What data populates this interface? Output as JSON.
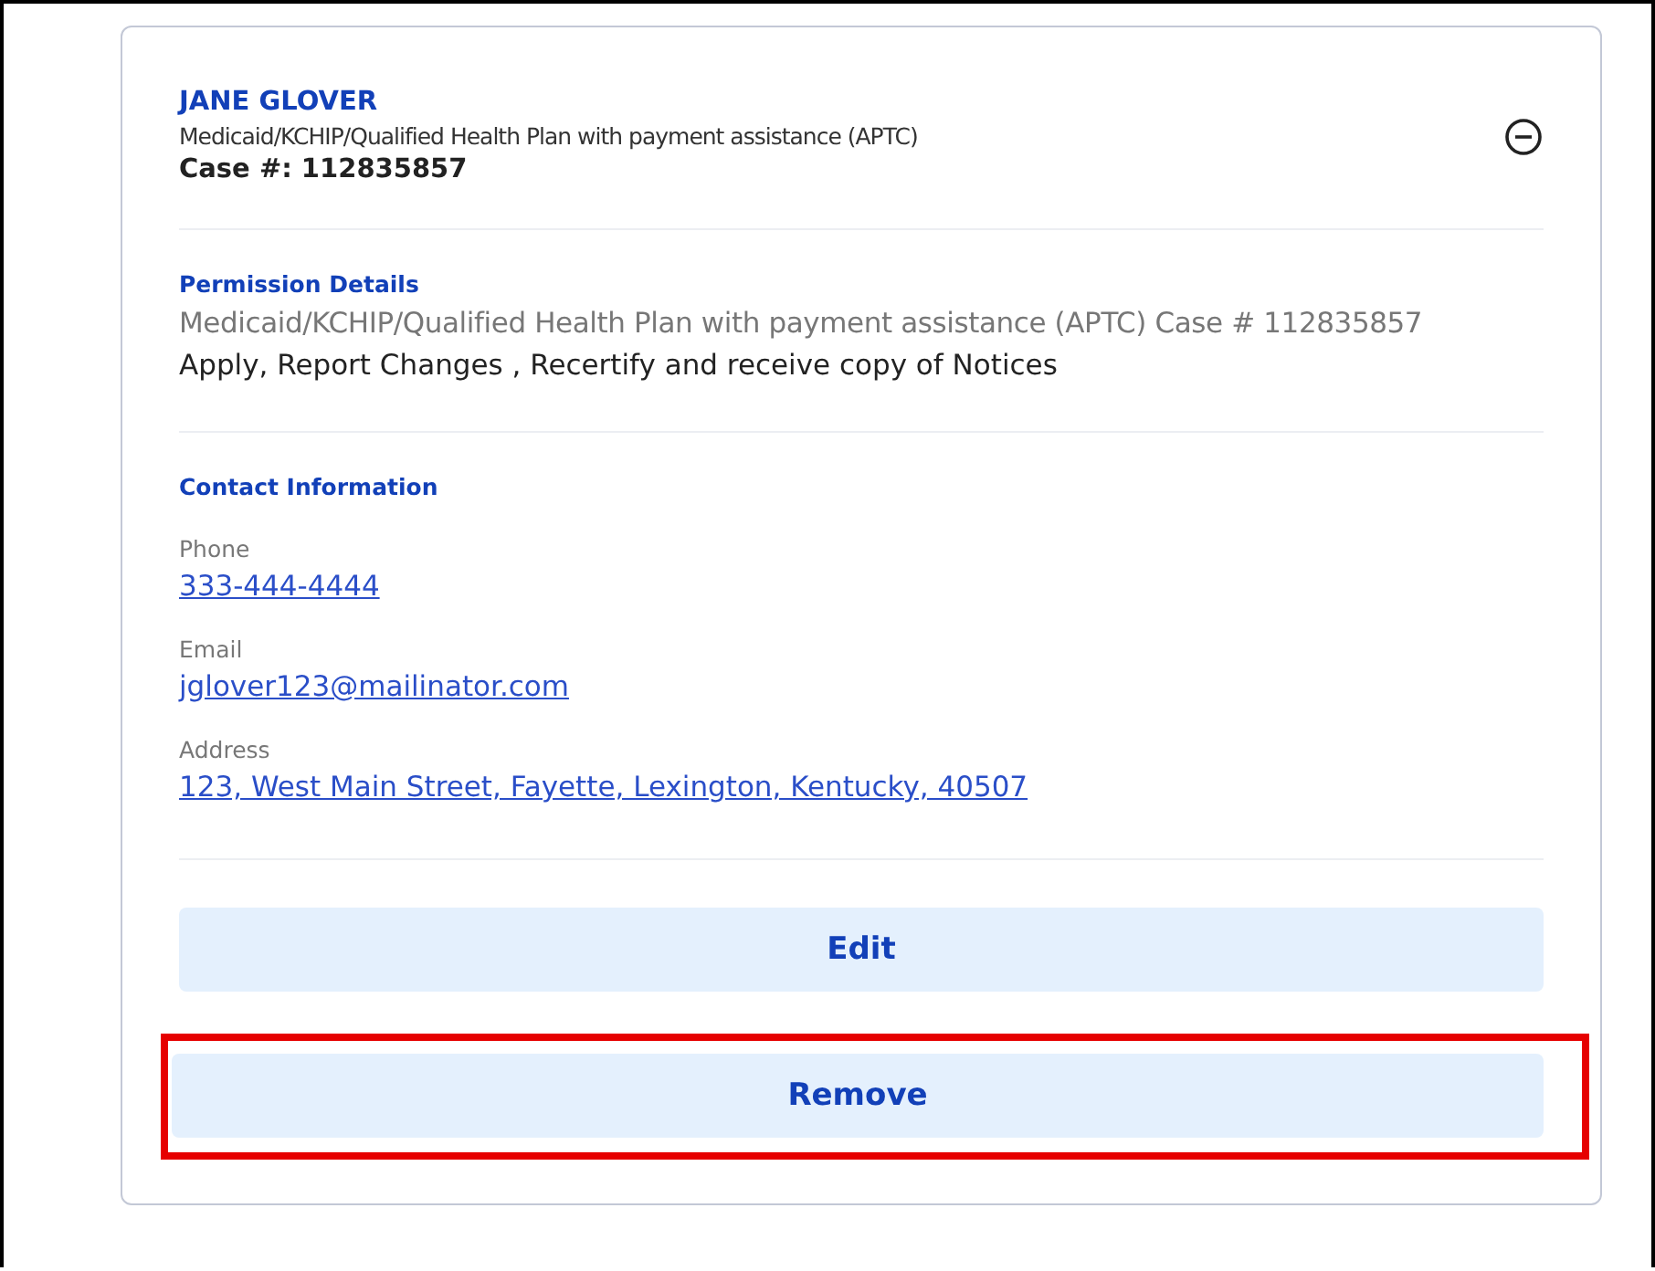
{
  "person": {
    "name": "JANE GLOVER",
    "program": "Medicaid/KCHIP/Qualified Health Plan with payment assistance (APTC)",
    "case": "Case #: 112835857",
    "expanded": true
  },
  "permission_details": {
    "title": "Permission Details",
    "program_case": "Medicaid/KCHIP/Qualified Health Plan with payment assistance (APTC) Case # 112835857",
    "permissions": "Apply, Report Changes , Recertify and receive copy of Notices"
  },
  "contact_information": {
    "title": "Contact Information",
    "fields": [
      {
        "label": "Phone",
        "value": "333-444-4444"
      },
      {
        "label": "Email",
        "value": "jglover123@mailinator.com"
      },
      {
        "label": "Address",
        "value": "123, West Main Street, Fayette, Lexington, Kentucky, 40507"
      }
    ]
  },
  "buttons": [
    {
      "label": "Edit",
      "highlighted": false
    },
    {
      "label": "Remove",
      "highlighted": true
    }
  ]
}
